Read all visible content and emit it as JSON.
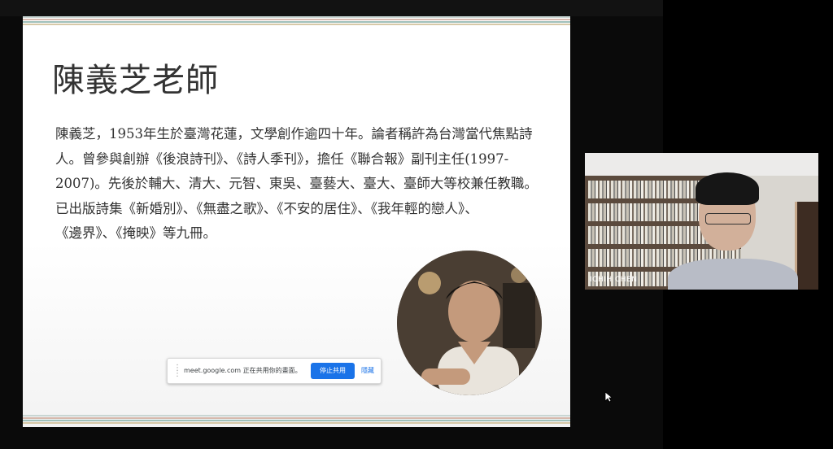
{
  "slide": {
    "title": "陳義芝老師",
    "body_lines": [
      "陳義芝，1953年生於臺灣花蓮，文學創作逾四十年。論者稱許為台灣當代焦點詩",
      "人。曾參與創辦《後浪詩刊》、《詩人季刊》，擔任《聯合報》副刊主任(1997-",
      "2007)。先後於輔大、清大、元智、東吳、臺藝大、臺大、臺師大等校兼任教職。",
      "已出版詩集《新婚別》、《無盡之歌》、《不安的居住》、《我年輕的戀人》、",
      "《邊界》、《掩映》等九冊。"
    ],
    "stripe_colors": [
      "#c9d6d3",
      "#d6b9ad",
      "#9fc0ba",
      "#d7c9a8"
    ]
  },
  "share_bar": {
    "message": "meet.google.com 正在共用你的畫面。",
    "stop_label": "停止共用",
    "hide_label": "隱藏"
  },
  "participant": {
    "name": "ICHIH CHEN"
  }
}
